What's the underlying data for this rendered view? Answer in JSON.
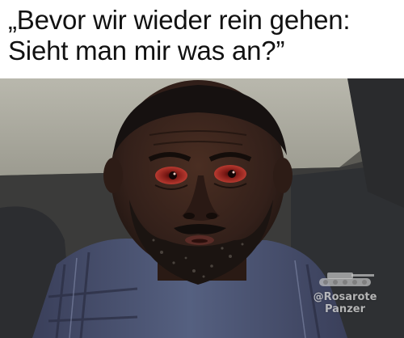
{
  "caption": {
    "line1": "„Bevor wir wieder rein gehen:",
    "line2": "Sieht man mir was an?”"
  },
  "watermark": {
    "handle": "@Rosarote",
    "name": "Panzer",
    "icon": "tank-icon"
  },
  "photo": {
    "subject": "man-face-icon"
  }
}
